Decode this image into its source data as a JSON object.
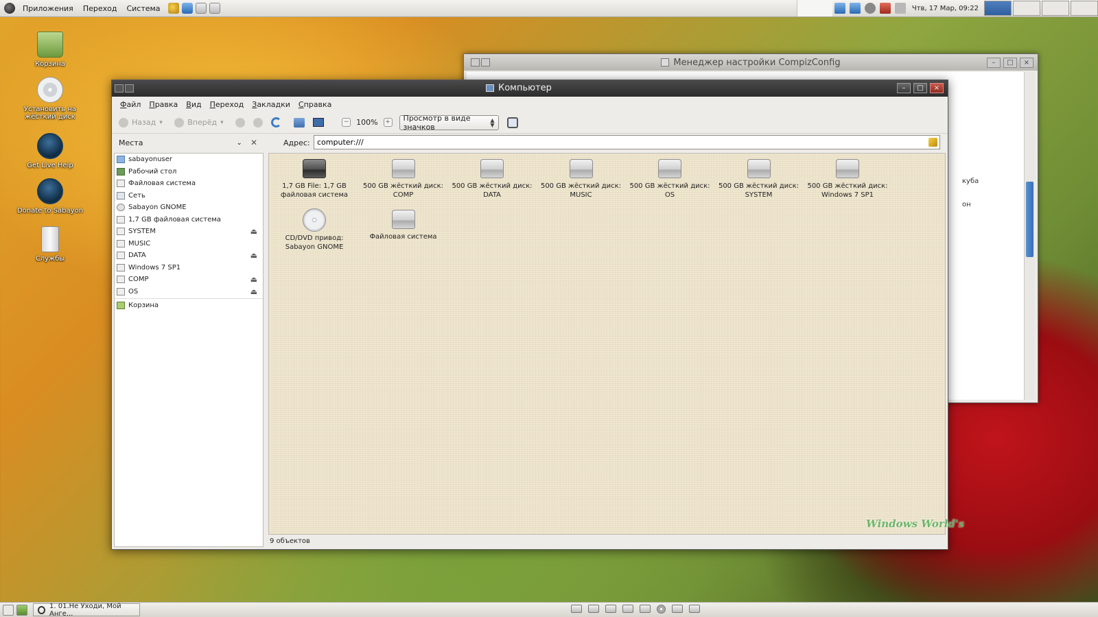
{
  "top_panel": {
    "menus": [
      "Приложения",
      "Переход",
      "Система"
    ],
    "clock": "Чтв, 17 Мар, 09:22"
  },
  "desktop_icons": [
    {
      "label": "Корзина",
      "icon": "trash-icon"
    },
    {
      "label": "Установить на жёсткий диск",
      "icon": "install-disc-icon"
    },
    {
      "label": "Get Live Help",
      "icon": "live-help-icon"
    },
    {
      "label": "Donate to Sabayon",
      "icon": "donate-icon"
    },
    {
      "label": "Службы",
      "icon": "services-icon"
    }
  ],
  "bg_window": {
    "title": "Менеджер настройки CompizConfig",
    "peek_1": "куба",
    "peek_2": "он"
  },
  "window": {
    "title": "Компьютер",
    "menus": [
      "Файл",
      "Правка",
      "Вид",
      "Переход",
      "Закладки",
      "Справка"
    ],
    "toolbar": {
      "back": "Назад",
      "forward": "Вперёд",
      "zoom": "100%",
      "view_mode": "Просмотр в виде значков"
    },
    "places_label": "Места",
    "address_label": "Адрес:",
    "address_value": "computer:///",
    "sidebar": [
      {
        "label": "sabayonuser",
        "icon": "home",
        "eject": false
      },
      {
        "label": "Рабочий стол",
        "icon": "desk",
        "eject": false
      },
      {
        "label": "Файловая система",
        "icon": "drive",
        "eject": false
      },
      {
        "label": "Сеть",
        "icon": "net",
        "eject": false
      },
      {
        "label": "Sabayon GNOME",
        "icon": "cd",
        "eject": false
      },
      {
        "label": "1,7 GB файловая система",
        "icon": "drive",
        "eject": false
      },
      {
        "label": "SYSTEM",
        "icon": "drive",
        "eject": true
      },
      {
        "label": "MUSIC",
        "icon": "drive",
        "eject": false
      },
      {
        "label": "DATA",
        "icon": "drive",
        "eject": true
      },
      {
        "label": "Windows 7 SP1",
        "icon": "drive",
        "eject": false
      },
      {
        "label": "COMP",
        "icon": "drive",
        "eject": true
      },
      {
        "label": "OS",
        "icon": "drive",
        "eject": true
      },
      {
        "label": "Корзина",
        "icon": "trash",
        "eject": false
      }
    ],
    "items": [
      {
        "line1": "1,7 GB File: 1,7 GB",
        "line2": "файловая система",
        "icon": "drive-dark"
      },
      {
        "line1": "500 GB жёсткий диск:",
        "line2": "COMP",
        "icon": "drive"
      },
      {
        "line1": "500 GB жёсткий диск:",
        "line2": "DATA",
        "icon": "drive"
      },
      {
        "line1": "500 GB жёсткий диск:",
        "line2": "MUSIC",
        "icon": "drive"
      },
      {
        "line1": "500 GB жёсткий диск:",
        "line2": "OS",
        "icon": "drive"
      },
      {
        "line1": "500 GB жёсткий диск:",
        "line2": "SYSTEM",
        "icon": "drive"
      },
      {
        "line1": "500 GB жёсткий диск:",
        "line2": "Windows 7 SP1",
        "icon": "drive"
      },
      {
        "line1": "CD/DVD привод:",
        "line2": "Sabayon GNOME",
        "icon": "disc"
      },
      {
        "line1": "Файловая система",
        "line2": "",
        "icon": "drive"
      }
    ],
    "status": "9 объектов"
  },
  "watermark": "Windows World's",
  "bottom_panel": {
    "task_title": "1. 01.Не Уходи, Мой Анге..."
  }
}
